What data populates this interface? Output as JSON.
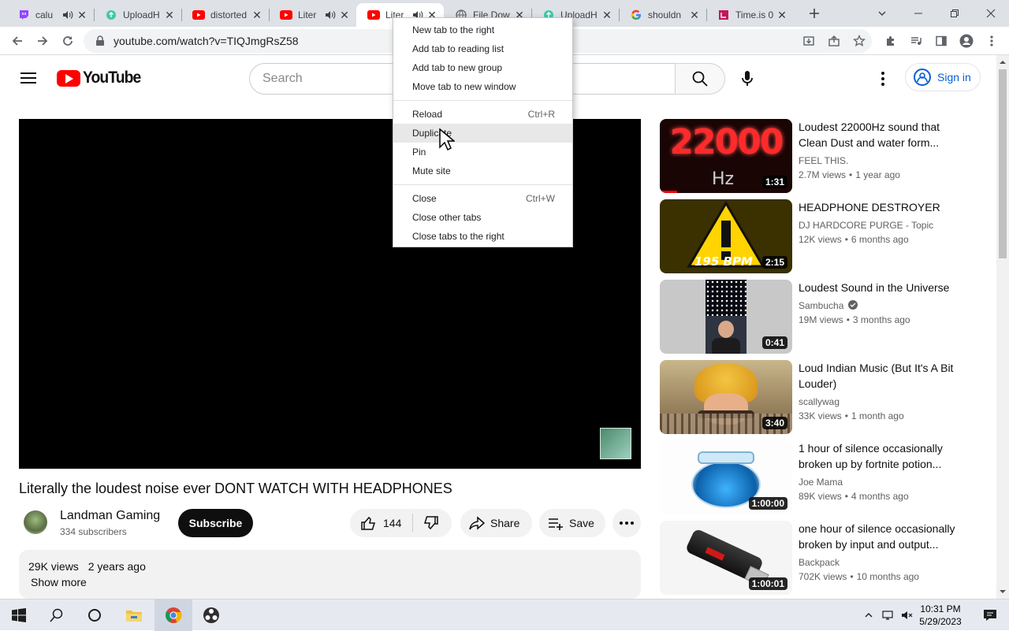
{
  "browser": {
    "tabs": [
      {
        "title": "calu",
        "favicon": "twitch-icon",
        "audio": true
      },
      {
        "title": "UploadH",
        "favicon": "upload-icon",
        "audio": false
      },
      {
        "title": "distorted",
        "favicon": "youtube-icon",
        "audio": false
      },
      {
        "title": "Liter",
        "favicon": "youtube-icon",
        "audio": true
      },
      {
        "title": "Liter",
        "favicon": "youtube-icon",
        "audio": true,
        "active": true
      },
      {
        "title": "File Dow",
        "favicon": "globe-icon",
        "audio": false
      },
      {
        "title": "UploadH",
        "favicon": "upload-icon",
        "audio": false
      },
      {
        "title": "shouldn",
        "favicon": "google-icon",
        "audio": false
      },
      {
        "title": "Time.is 0",
        "favicon": "timeis-icon",
        "audio": false
      }
    ],
    "url": "youtube.com/watch?v=TIQJmgRsZ58"
  },
  "context_menu": {
    "items": [
      {
        "label": "New tab to the right",
        "shortcut": ""
      },
      {
        "label": "Add tab to reading list",
        "shortcut": ""
      },
      {
        "label": "Add tab to new group",
        "shortcut": ""
      },
      {
        "label": "Move tab to new window",
        "shortcut": ""
      },
      {
        "label": "Reload",
        "shortcut": "Ctrl+R"
      },
      {
        "label": "Duplicate",
        "shortcut": ""
      },
      {
        "label": "Pin",
        "shortcut": ""
      },
      {
        "label": "Mute site",
        "shortcut": ""
      },
      {
        "label": "Close",
        "shortcut": "Ctrl+W"
      },
      {
        "label": "Close other tabs",
        "shortcut": ""
      },
      {
        "label": "Close tabs to the right",
        "shortcut": ""
      }
    ],
    "hovered": "Duplicate"
  },
  "youtube": {
    "logo_text": "YouTube",
    "search_placeholder": "Search",
    "signin_label": "Sign in",
    "video": {
      "title": "Literally the loudest noise ever DONT WATCH WITH HEADPHONES",
      "channel": "Landman Gaming",
      "subscribers": "334 subscribers",
      "subscribe_label": "Subscribe",
      "likes": "144",
      "share_label": "Share",
      "save_label": "Save",
      "views": "29K views",
      "age": "2 years ago",
      "show_more": "Show more"
    },
    "related": [
      {
        "title": "Loudest 22000Hz sound that Clean Dust and water form...",
        "channel": "FEEL THIS.",
        "views": "2.7M views",
        "age": "1 year ago",
        "duration": "1:31",
        "verified": false
      },
      {
        "title": "HEADPHONE DESTROYER",
        "channel": "DJ HARDCORE PURGE - Topic",
        "views": "12K views",
        "age": "6 months ago",
        "duration": "2:15",
        "verified": false
      },
      {
        "title": "Loudest Sound in the Universe",
        "channel": "Sambucha",
        "views": "19M views",
        "age": "3 months ago",
        "duration": "0:41",
        "verified": true
      },
      {
        "title": "Loud Indian Music (But It's A Bit Louder)",
        "channel": "scallywag",
        "views": "33K views",
        "age": "1 month ago",
        "duration": "3:40",
        "verified": false
      },
      {
        "title": "1 hour of silence occasionally broken up by fortnite potion...",
        "channel": "Joe Mama",
        "views": "89K views",
        "age": "4 months ago",
        "duration": "1:00:00",
        "verified": false
      },
      {
        "title": "one hour of silence occasionally broken by input and output...",
        "channel": "Backpack",
        "views": "702K views",
        "age": "10 months ago",
        "duration": "1:00:01",
        "verified": false
      }
    ],
    "thumb_texts": {
      "hz_big": "22000",
      "hz_small": "Hz",
      "bpm": "195 BPM"
    }
  },
  "taskbar": {
    "time": "10:31 PM",
    "date": "5/29/2023"
  },
  "colors": {
    "youtube_red": "#ff0000",
    "link_blue": "#065fd4",
    "chrome_frame": "#dee1e6"
  }
}
